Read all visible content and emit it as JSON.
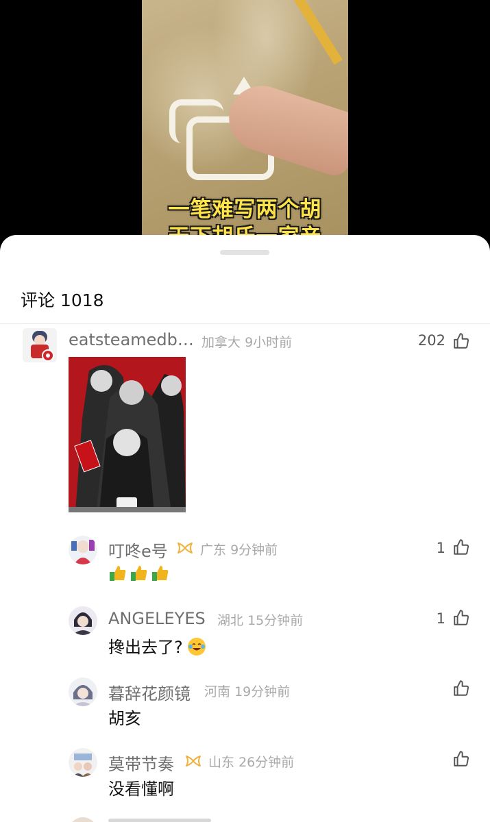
{
  "video": {
    "caption_line1": "一笔难写两个胡",
    "caption_line2": "天下胡氏一家亲"
  },
  "comments": {
    "title": "评论 1018",
    "main": {
      "username": "eatsteamedb…",
      "location": "加拿大",
      "time": "9小时前",
      "likes": "202"
    },
    "replies": [
      {
        "username": "叮咚e号",
        "has_badge": true,
        "location": "广东",
        "time": "9分钟前",
        "likes": "1",
        "text": ""
      },
      {
        "username": "ANGELEYES",
        "has_badge": false,
        "location": "湖北",
        "time": "15分钟前",
        "likes": "1",
        "text": "搀出去了?"
      },
      {
        "username": "暮辞花颜镜",
        "has_badge": false,
        "location": "河南",
        "time": "19分钟前",
        "likes": "",
        "text": "胡亥"
      },
      {
        "username": "莫带节奏",
        "has_badge": true,
        "location": "山东",
        "time": "26分钟前",
        "likes": "",
        "text": "没看懂啊"
      }
    ]
  },
  "colors": {
    "caption": "#ffe34a",
    "badge": "#f0b23a",
    "sheet_bg": "#ffffff"
  },
  "icons": [
    "thumbs-up-icon",
    "thumbs-up-emoji",
    "laughing-crying-emoji",
    "badge-icon"
  ]
}
